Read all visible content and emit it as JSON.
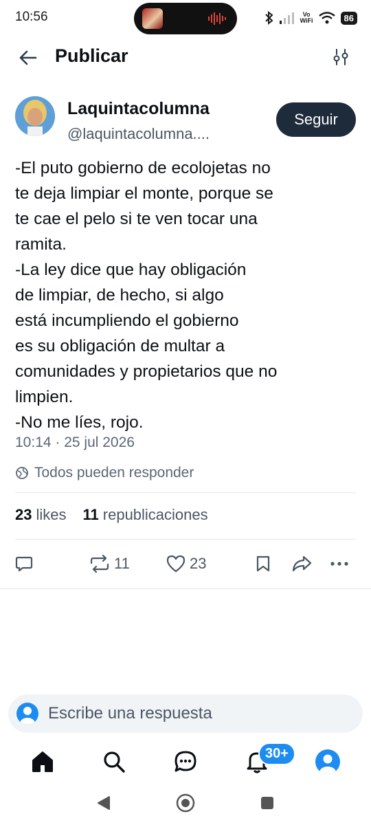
{
  "status_bar": {
    "time": "10:56",
    "vowifi_top": "Vo",
    "vowifi_bottom": "WiFi",
    "battery": "86"
  },
  "header": {
    "title": "Publicar",
    "back_icon": "arrow-left-icon",
    "options_icon": "sliders-icon"
  },
  "author": {
    "name": "Laquintacolumna",
    "handle": "@laquintacolumna....",
    "follow_label": "Seguir"
  },
  "post": {
    "lines": [
      "-El puto gobierno de ecolojetas no",
      "te deja limpiar el monte, porque se",
      "te cae el pelo si te ven tocar una",
      "ramita.",
      "-La ley dice que hay obligación",
      "de limpiar, de hecho, si algo",
      "está incumpliendo el gobierno",
      "es su obligación de multar a",
      "comunidades y propietarios que no",
      "limpien.",
      "-No me líes, rojo."
    ],
    "timestamp": "10:14 · 25 jul 2026",
    "reply_setting": "Todos pueden responder"
  },
  "stats": {
    "likes_count": "23",
    "likes_label": "likes",
    "reposts_count": "11",
    "reposts_label": "republicaciones"
  },
  "actions": {
    "reply_icon": "comment-icon",
    "repost_count": "11",
    "like_count": "23",
    "bookmark_icon": "bookmark-icon",
    "share_icon": "share-icon",
    "more_icon": "ellipsis-icon"
  },
  "reply_box": {
    "placeholder": "Escribe una respuesta"
  },
  "bottom_nav": {
    "notifications_badge": "30+"
  },
  "colors": {
    "accent": "#1d8cf0",
    "follow_button": "#1e2b3a",
    "muted_text": "#5b6675"
  }
}
